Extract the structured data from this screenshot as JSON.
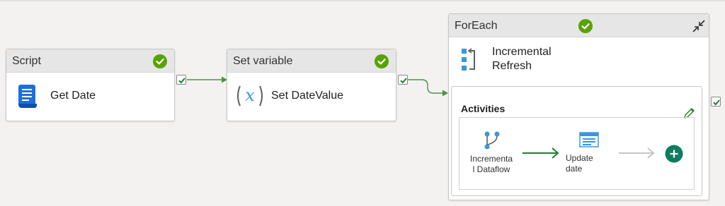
{
  "pipeline": {
    "activities": [
      {
        "type_label": "Script",
        "name": "Get Date",
        "status": "succeeded",
        "icon": "script-icon"
      },
      {
        "type_label": "Set variable",
        "name": "Set DateValue",
        "status": "succeeded",
        "icon": "variable-icon"
      }
    ],
    "foreach": {
      "type_label": "ForEach",
      "status": "succeeded",
      "name_line1": "Incremental",
      "name_line2": "Refresh",
      "icon": "foreach-icon",
      "collapse_icon": "collapse-icon",
      "activities_label": "Activities",
      "edit_icon": "pencil-icon",
      "inner": [
        {
          "line1": "Incrementa",
          "line2": "l Dataflow",
          "icon": "dataflow-icon"
        },
        {
          "line1": "Update",
          "line2": "date",
          "icon": "table-icon"
        }
      ],
      "add_icon": "plus-icon"
    }
  },
  "colors": {
    "success": "#57a300",
    "connector": "#4f8f4f",
    "inner_connector": "#1e7d32",
    "disabled_connector": "#c8c6c4",
    "add_button": "#0f7b5f",
    "script_icon": "#1e6fd9",
    "foreach_icon": "#3a96dd"
  }
}
